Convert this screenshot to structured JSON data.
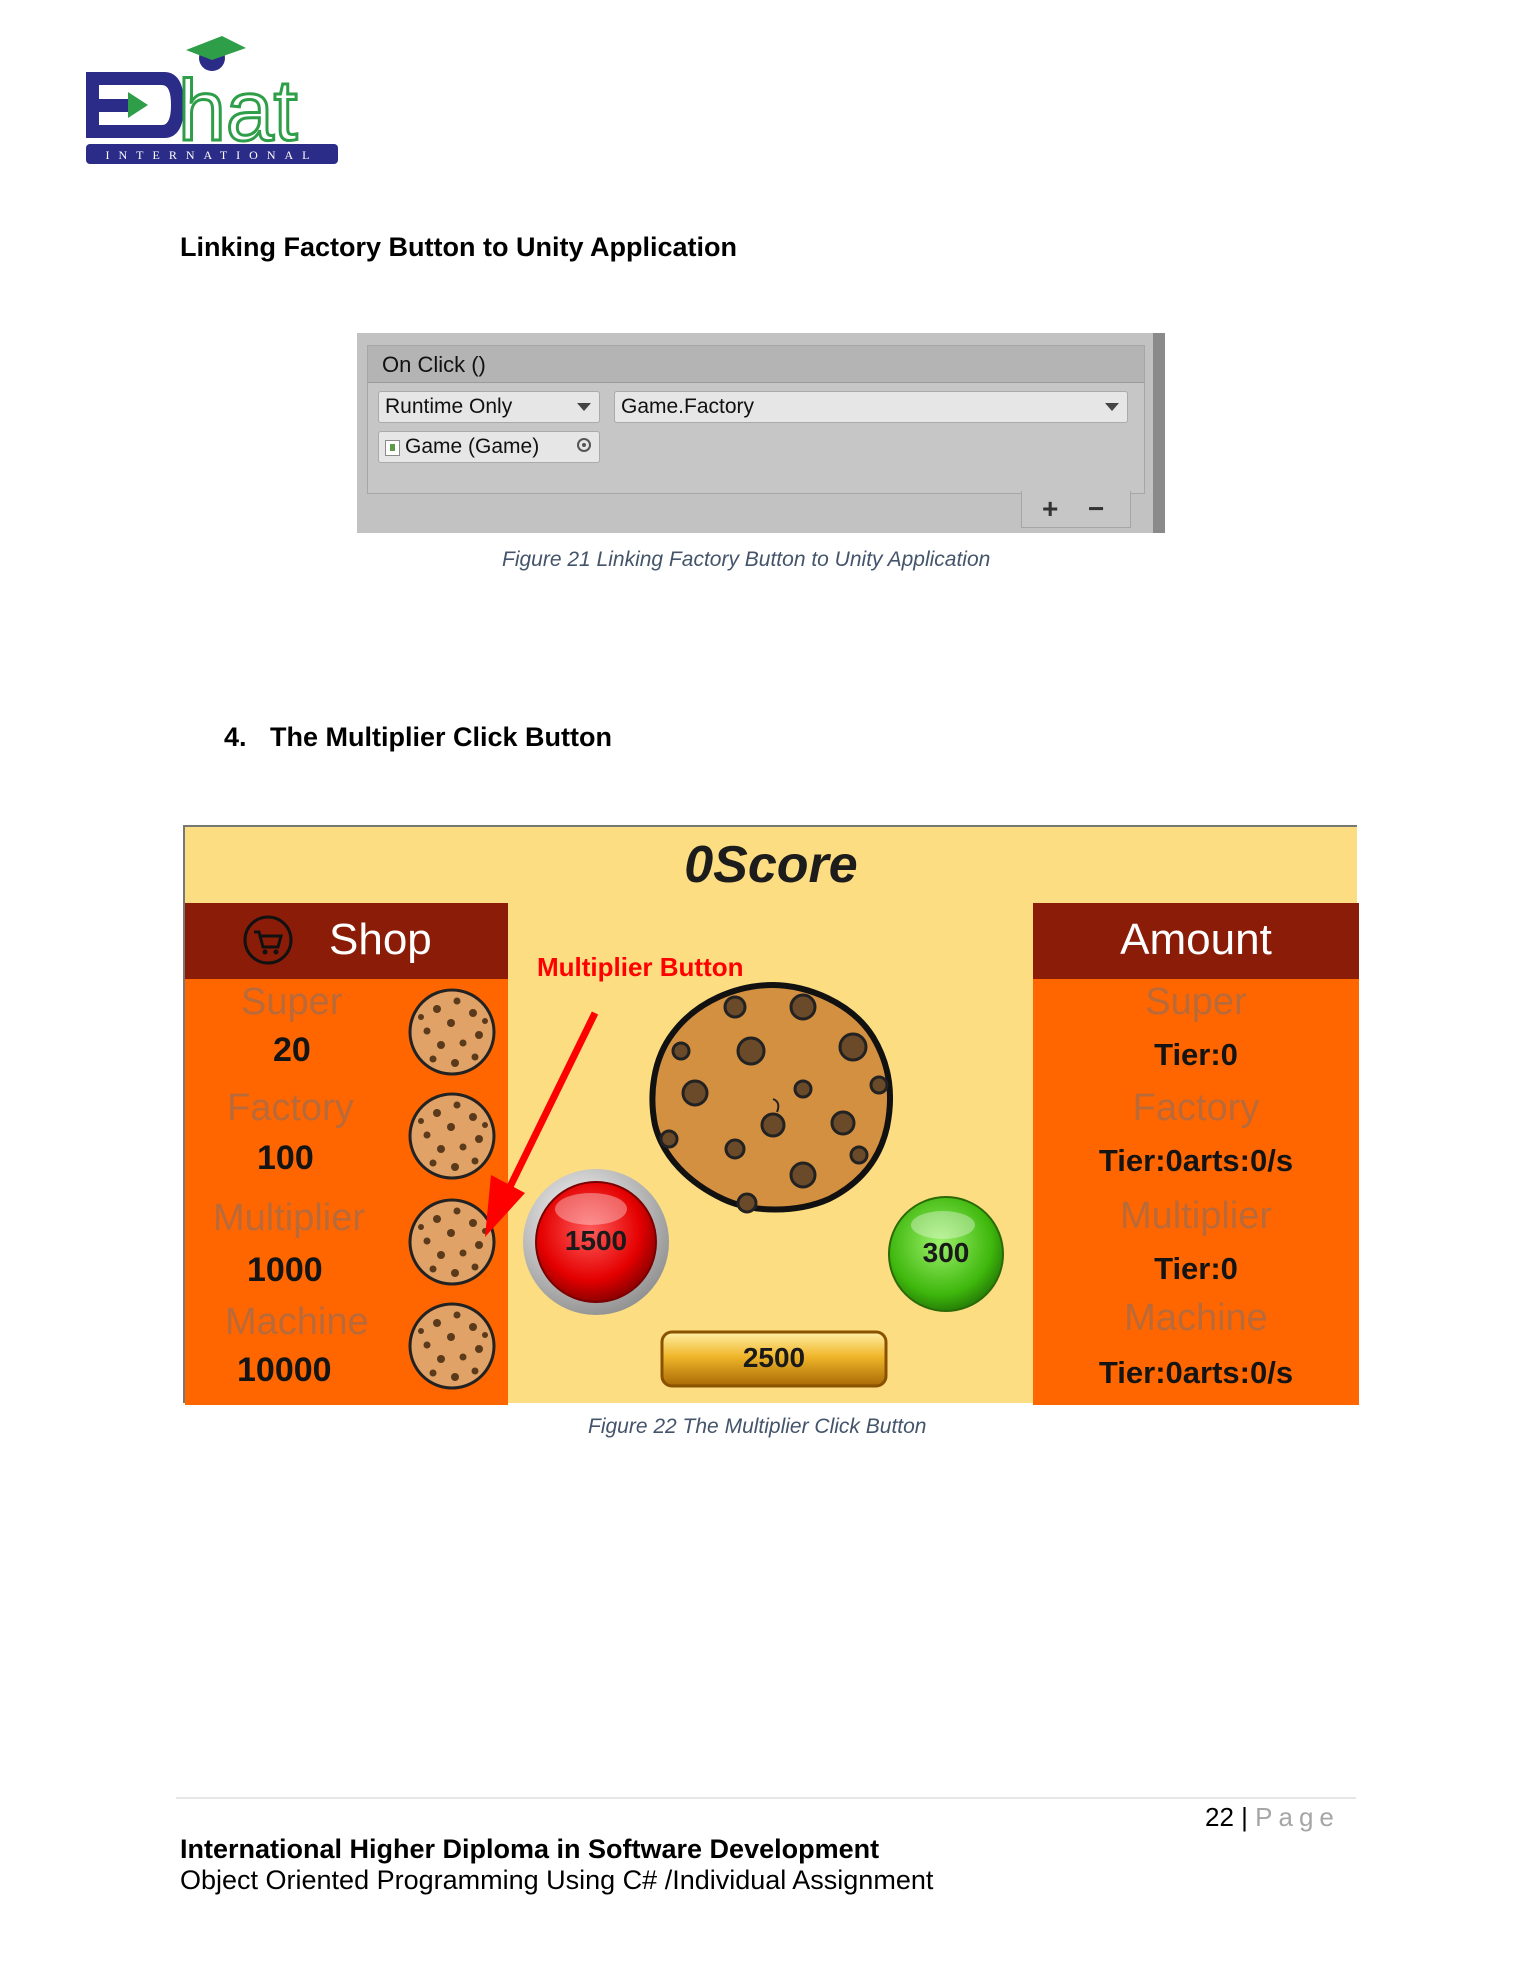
{
  "logo": {
    "text": "hat",
    "sub": "INTERNATIONAL",
    "colors": {
      "navy": "#2b2c88",
      "green": "#2e9e48"
    }
  },
  "section_heading": "Linking Factory Button to Unity Application",
  "unity_panel": {
    "header": "On Click ()",
    "runtime": "Runtime Only",
    "method": "Game.Factory",
    "object": "Game (Game)",
    "plus": "+",
    "minus": "−"
  },
  "caption_21": "Figure 21 Linking Factory Button to Unity Application",
  "list_heading": {
    "number": "4.",
    "text": "The Multiplier Click Button"
  },
  "game": {
    "score": "0Score",
    "shop": {
      "title": "Shop",
      "items": [
        {
          "label": "Super",
          "value": "20"
        },
        {
          "label": "Factory",
          "value": "100"
        },
        {
          "label": "Multiplier",
          "value": "1000"
        },
        {
          "label": "Machine",
          "value": "10000"
        }
      ]
    },
    "amount": {
      "title": "Amount",
      "items": [
        {
          "label": "Super",
          "value": "Tier:0"
        },
        {
          "label": "Factory",
          "value": "Tier:0arts:0/s"
        },
        {
          "label": "Multiplier",
          "value": "Tier:0"
        },
        {
          "label": "Machine",
          "value": "Tier:0arts:0/s"
        }
      ]
    },
    "annotation": "Multiplier Button",
    "red_button": "1500",
    "green_button": "300",
    "gold_button": "2500",
    "colors": {
      "bg": "#fcdd82",
      "panel": "#ff6600",
      "header": "#8b1d08",
      "annotation": "#ff0000"
    }
  },
  "caption_22": "Figure 22 The Multiplier Click Button",
  "footer": {
    "page_number": "22",
    "separator": "|",
    "page_word": "Page",
    "title": "International Higher Diploma in Software Development",
    "subtitle": "Object Oriented Programming Using C# /Individual Assignment"
  }
}
